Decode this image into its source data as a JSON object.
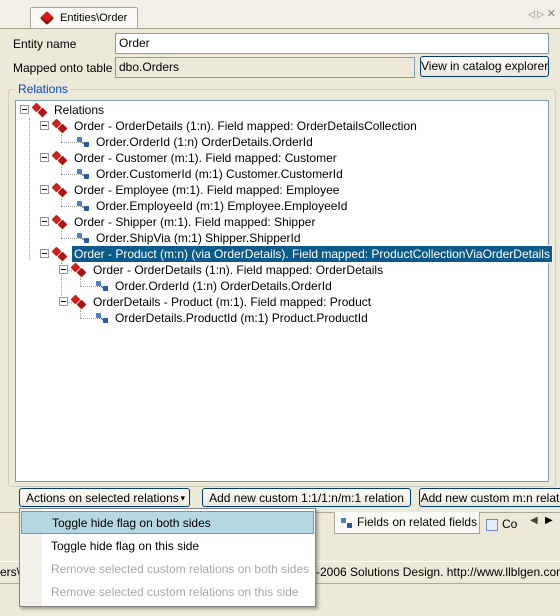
{
  "document_tab": {
    "title": "Entities\\Order"
  },
  "form": {
    "entity_name_label": "Entity name",
    "entity_name_value": "Order",
    "mapped_label": "Mapped onto table",
    "mapped_value": "dbo.Orders",
    "catalog_button": "View in catalog explorer"
  },
  "relations": {
    "group_label": "Relations",
    "root_label": "Relations",
    "nodes": [
      {
        "label": "Order - OrderDetails (1:n). Field mapped: OrderDetailsCollection",
        "fields": [
          "Order.OrderId (1:n) OrderDetails.OrderId"
        ]
      },
      {
        "label": "Order - Customer (m:1). Field mapped: Customer",
        "fields": [
          "Order.CustomerId (m:1) Customer.CustomerId"
        ]
      },
      {
        "label": "Order - Employee (m:1). Field mapped: Employee",
        "fields": [
          "Order.EmployeeId (m:1) Employee.EmployeeId"
        ]
      },
      {
        "label": "Order - Shipper (m:1). Field mapped: Shipper",
        "fields": [
          "Order.ShipVia (m:1) Shipper.ShipperId"
        ]
      },
      {
        "label": "Order - Product (m:n) (via OrderDetails). Field mapped: ProductCollectionViaOrderDetails",
        "selected": true,
        "children": [
          {
            "label": "Order - OrderDetails (1:n). Field mapped: OrderDetails",
            "fields": [
              "Order.OrderId (1:n) OrderDetails.OrderId"
            ]
          },
          {
            "label": "OrderDetails - Product (m:1). Field mapped: Product",
            "fields": [
              "OrderDetails.ProductId (m:1) Product.ProductId"
            ]
          }
        ]
      }
    ]
  },
  "actions": {
    "dropdown_label": "Actions on selected relations",
    "add_custom_1n": "Add new custom 1:1/1:n/m:1 relation",
    "add_custom_mn": "Add new custom m:n relat"
  },
  "sub_tabs": {
    "tab_a_fragment": "s",
    "tab_b": "Fields on related fields",
    "tab_c_fragment": "Co"
  },
  "status": {
    "left_fragment": "ers\\",
    "right_fragment": "-2006 Solutions Design. http://www.llblgen.com"
  },
  "menu": {
    "items": [
      {
        "label": "Toggle hide flag on both sides",
        "state": "highlighted"
      },
      {
        "label": "Toggle hide flag on this side",
        "state": "enabled"
      },
      {
        "label": "Remove selected custom relations on both sides",
        "state": "disabled"
      },
      {
        "label": "Remove selected custom relations on this side",
        "state": "disabled"
      }
    ]
  },
  "colors": {
    "selection": "#0a5a8a",
    "menu_highlight": "#b5d7e0",
    "group_label": "#0046d5",
    "relation_icon": "#cf1f1f"
  }
}
